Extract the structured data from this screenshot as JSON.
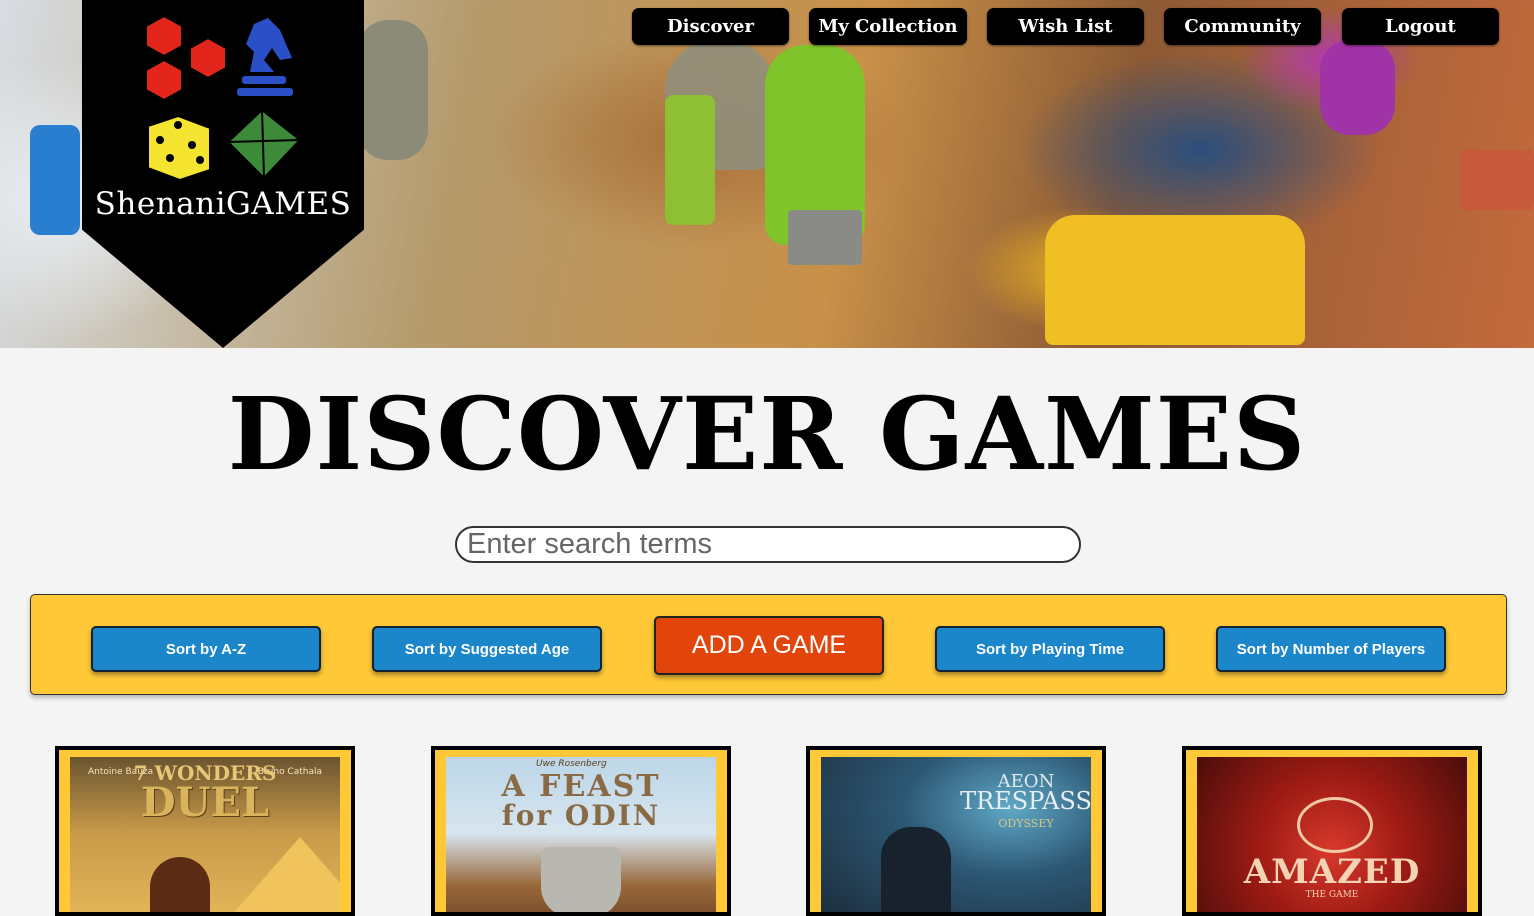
{
  "brand": {
    "name": "ShenaniGAMES"
  },
  "nav": {
    "items": [
      {
        "label": "Discover"
      },
      {
        "label": "My Collection"
      },
      {
        "label": "Wish List"
      },
      {
        "label": "Community"
      },
      {
        "label": "Logout"
      }
    ]
  },
  "page": {
    "title": "DISCOVER GAMES"
  },
  "search": {
    "placeholder": "Enter search terms",
    "value": ""
  },
  "toolbar": {
    "sort_az": "Sort by A-Z",
    "sort_age": "Sort by Suggested Age",
    "add_game": "ADD A GAME",
    "sort_time": "Sort by Playing Time",
    "sort_players": "Sort by Number of Players"
  },
  "games": [
    {
      "title_line1": "7 WONDERS",
      "title_line2": "DUEL",
      "credit_left": "Antoine Bauza",
      "credit_right": "Bruno Cathala"
    },
    {
      "title_line1": "A FEAST",
      "title_line2": "for ODIN",
      "credit_left": "Uwe Rosenberg",
      "credit_right": ""
    },
    {
      "title_line1": "AEON",
      "title_line2": "TRESPASS",
      "title_line3": "ODYSSEY",
      "credit_left": "",
      "credit_right": ""
    },
    {
      "title_line1": "AMAZED",
      "title_line2": "THE GAME",
      "credit_left": "",
      "credit_right": ""
    }
  ],
  "colors": {
    "toolbar_bg": "#fec837",
    "sort_button": "#1b86c9",
    "add_button": "#e2450b",
    "nav_button": "#000000",
    "logo_red": "#e3261c",
    "logo_blue": "#2b4fc7",
    "logo_yellow": "#f5e531",
    "logo_green": "#3d8a3a"
  }
}
